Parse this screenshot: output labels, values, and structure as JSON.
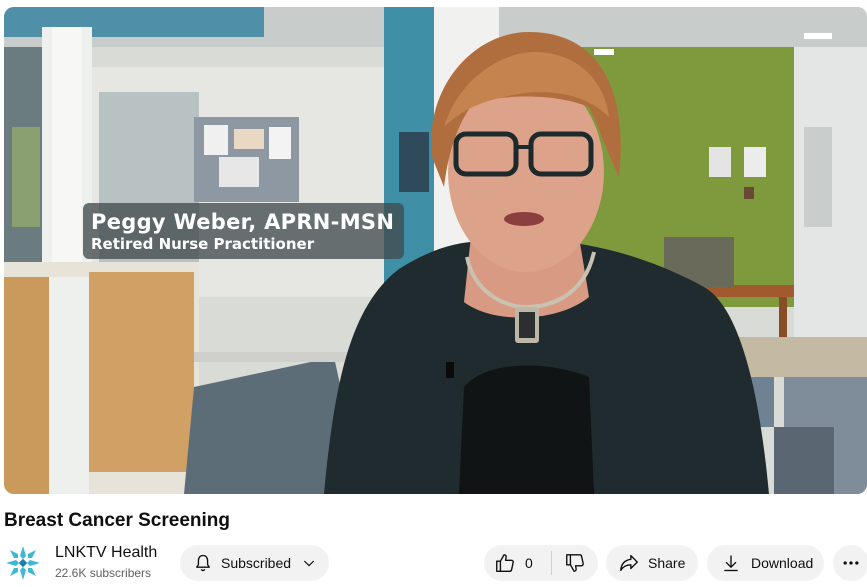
{
  "video": {
    "lower_third_name": "Peggy Weber, APRN-MSN",
    "lower_third_title": "Retired Nurse Practitioner"
  },
  "title": "Breast Cancer Screening",
  "channel": {
    "name": "LNKTV Health",
    "subscribers": "22.6K subscribers",
    "avatar_icon": "snowflake-logo-icon",
    "avatar_color": "#3fb8d4"
  },
  "actions": {
    "subscribe_label": "Subscribed",
    "like_count": "0",
    "share_label": "Share",
    "download_label": "Download"
  },
  "icons": {
    "bell": "bell-icon",
    "chevron": "chevron-down-icon",
    "like": "thumbs-up-icon",
    "dislike": "thumbs-down-icon",
    "share": "share-arrow-icon",
    "download": "download-icon",
    "more": "more-horizontal-icon"
  }
}
